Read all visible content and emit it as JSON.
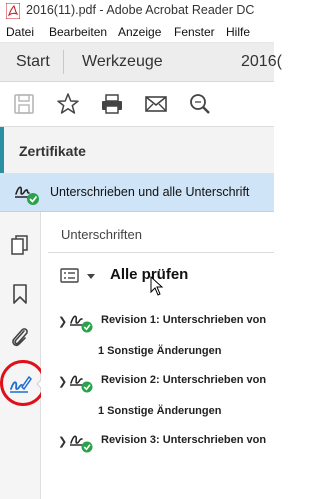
{
  "window": {
    "title": "2016(11).pdf - Adobe Acrobat Reader DC"
  },
  "menu": [
    "Datei",
    "Bearbeiten",
    "Anzeige",
    "Fenster",
    "Hilfe"
  ],
  "tabs": {
    "start": "Start",
    "tools": "Werkzeuge",
    "document": "2016("
  },
  "toolbar": {
    "icons": [
      "save-icon",
      "bookmark-star-icon",
      "print-icon",
      "email-icon",
      "search-zoom-icon"
    ]
  },
  "panel": {
    "title": "Zertifikate",
    "banner": "Unterschrieben und alle Unterschrift",
    "section_label": "Unterschriften",
    "validate_all": "Alle prüfen",
    "revisions": [
      {
        "label": "Revision 1: Unterschrieben von",
        "changes": "1 Sonstige Änderungen"
      },
      {
        "label": "Revision 2: Unterschrieben von",
        "changes": "1 Sonstige Änderungen"
      },
      {
        "label": "Revision 3: Unterschrieben von",
        "changes": ""
      }
    ]
  },
  "rail": {
    "icons": [
      "pages-icon",
      "bookmark-icon",
      "attachment-icon",
      "signature-icon"
    ]
  },
  "colors": {
    "accent": "#2a8fa3",
    "banner": "#cfe4f6",
    "highlight": "#e0101a",
    "valid": "#2aa14a"
  }
}
